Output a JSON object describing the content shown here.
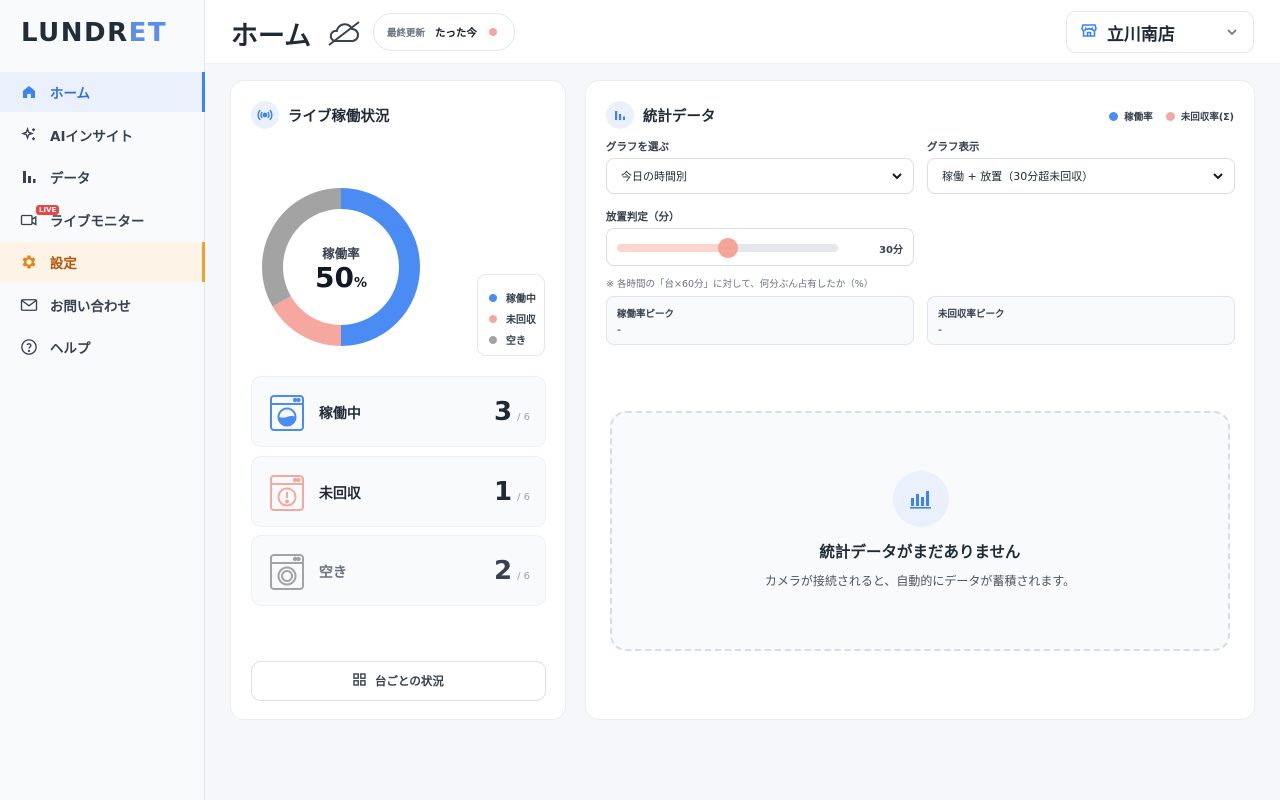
{
  "brand": {
    "logo_main": "LUNDR",
    "logo_accent": "ET"
  },
  "sidebar": {
    "items": [
      {
        "label": "ホーム",
        "icon": "home-icon"
      },
      {
        "label": "AIインサイト",
        "icon": "sparkle-icon"
      },
      {
        "label": "データ",
        "icon": "bar-chart-icon"
      },
      {
        "label": "ライブモニター",
        "icon": "video-camera-icon",
        "badge": "LIVE"
      },
      {
        "label": "設定",
        "icon": "gear-icon"
      },
      {
        "label": "お問い合わせ",
        "icon": "mail-icon"
      },
      {
        "label": "ヘルプ",
        "icon": "help-circle-icon"
      }
    ]
  },
  "header": {
    "title": "ホーム",
    "update_label": "最終更新",
    "update_value": "たった今",
    "store_name": "立川南店"
  },
  "live": {
    "title": "ライブ稼働状況",
    "donut_label": "稼働率",
    "donut_value": "50",
    "donut_unit": "%",
    "legend": [
      "稼働中",
      "未回収",
      "空き"
    ],
    "tiles": [
      {
        "label": "稼働中",
        "count": "3",
        "total": "/ 6"
      },
      {
        "label": "未回収",
        "count": "1",
        "total": "/ 6"
      },
      {
        "label": "空き",
        "count": "2",
        "total": "/ 6"
      }
    ],
    "machine_button": "台ごとの状況"
  },
  "chart_data": {
    "type": "pie",
    "categories": [
      "稼働中",
      "未回収",
      "空き"
    ],
    "values": [
      3,
      1,
      2
    ],
    "colors": [
      "#4b8bf4",
      "#f6a8a0",
      "#a3a3a3"
    ]
  },
  "stats": {
    "title": "統計データ",
    "legend": [
      "稼働率",
      "未回収率(Σ)"
    ],
    "legend_colors": [
      "#4b8bf4",
      "#f6a8a0"
    ],
    "graph_select_label": "グラフを選ぶ",
    "graph_select_value": "今日の時間別",
    "graph_display_label": "グラフ表示",
    "graph_display_value": "稼働 + 放置（30分超未回収）",
    "threshold_label": "放置判定（分）",
    "threshold_value": "30分",
    "threshold_fraction": 0.5,
    "hint": "※ 各時間の「台×60分」に対して、何分ぶん占有したか（%）",
    "peak_util_label": "稼働率ピーク",
    "peak_util_value": "-",
    "peak_uncollected_label": "未回収率ピーク",
    "peak_uncollected_value": "-",
    "empty_title": "統計データがまだありません",
    "empty_sub": "カメラが接続されると、自動的にデータが蓄積されます。"
  }
}
